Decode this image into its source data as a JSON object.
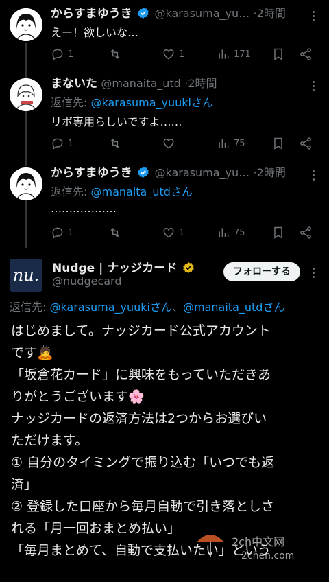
{
  "tweets": [
    {
      "name": "からすまゆうき",
      "handle": "@karasuma_yu…",
      "time": "2時間",
      "text": "えー！欲しいな…",
      "replies": "1",
      "retweets": "",
      "likes": "1",
      "views": "171"
    },
    {
      "name": "まないた",
      "handle": "@manaita_utd",
      "time": "2時間",
      "reply_prefix": "返信先: ",
      "reply_mention": "@karasuma_yuukiさん",
      "text": "リボ専用らしいですよ……",
      "replies": "1",
      "retweets": "",
      "likes": "",
      "views": "75"
    },
    {
      "name": "からすまゆうき",
      "handle": "@karasuma_yu…",
      "time": "2時間",
      "reply_prefix": "返信先: ",
      "reply_mention": "@manaita_utdさん",
      "text": "………………",
      "replies": "1",
      "retweets": "",
      "likes": "1",
      "views": "75"
    }
  ],
  "nudge": {
    "name": "Nudge | ナッジカード",
    "handle": "@nudgecard",
    "logo_text": "nu.",
    "follow_label": "フォローする",
    "reply_prefix": "返信先: ",
    "reply_mention_1": "@karasuma_yuukiさん",
    "reply_sep": "、",
    "reply_mention_2": "@manaita_utdさん",
    "lines": [
      "はじめまして。ナッジカード公式アカウント",
      "です🙇",
      "「坂倉花カード」に興味をもっていただきあ",
      "りがとうございます🌸",
      "",
      "ナッジカードの返済方法は2つからお選びい",
      "ただけます。",
      "① 自分のタイミングで振り込む「いつでも返",
      "済」",
      "② 登録した口座から毎月自動で引き落としさ",
      "れる「月一回おまとめ払い」",
      "「毎月まとめて、自動で支払いたい」という"
    ]
  },
  "watermark": {
    "line1": "2ch中文网",
    "line2": "2chen.com"
  },
  "colors": {
    "accent": "#1d9bf0",
    "muted": "#71767b",
    "verified": "#1d9bf0",
    "gold_verified": "#e2b719"
  }
}
